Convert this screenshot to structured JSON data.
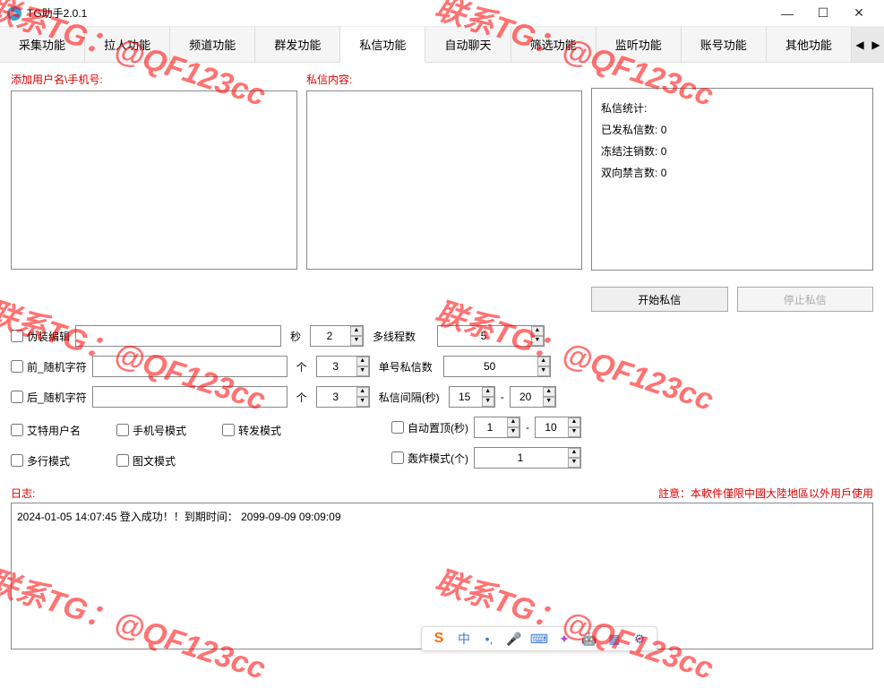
{
  "window": {
    "title": "TG助手2.0.1",
    "min": "—",
    "max": "☐",
    "close": "✕"
  },
  "tabs": {
    "items": [
      "采集功能",
      "拉人功能",
      "频道功能",
      "群发功能",
      "私信功能",
      "自动聊天",
      "筛选功能",
      "监听功能",
      "账号功能",
      "其他功能"
    ],
    "scroll_left": "◀",
    "scroll_right": "▶",
    "active_index": 4
  },
  "labels": {
    "add_users": "添加用户名\\手机号:",
    "pm_content": "私信内容:",
    "stats_title": "私信统计:",
    "sent_count": "已发私信数:",
    "frozen_count": "冻结注销数:",
    "banned_count": "双向禁言数:",
    "fake_edit": "伪装编辑",
    "prefix_random": "前_随机字符",
    "suffix_random": "后_随机字符",
    "sec": "秒",
    "count_unit": "个",
    "threads": "多线程数",
    "per_account": "单号私信数",
    "pm_interval": "私信间隔(秒)",
    "auto_pin": "自动置顶(秒)",
    "bomb_mode": "轰炸模式(个)",
    "at_user": "艾特用户名",
    "phone_mode": "手机号模式",
    "forward_mode": "转发模式",
    "multiline": "多行模式",
    "image_text": "图文模式",
    "start_btn": "开始私信",
    "stop_btn": "停止私信",
    "dash": "-",
    "log": "日志:",
    "warning": "註意：本軟件僅限中國大陸地區以外用戶使用"
  },
  "values": {
    "sent": "0",
    "frozen": "0",
    "banned": "0",
    "fake_sec": "2",
    "threads": "5",
    "prefix_n": "3",
    "per_account": "50",
    "suffix_n": "3",
    "interval_min": "15",
    "interval_max": "20",
    "pin_min": "1",
    "pin_max": "10",
    "bomb_n": "1"
  },
  "log": {
    "line1": "2024-01-05 14:07:45 登入成功！！到期时间： 2099-09-09 09:09:09"
  },
  "ime": {
    "lang": "中"
  },
  "watermark": "联系TG：@QF123cc"
}
